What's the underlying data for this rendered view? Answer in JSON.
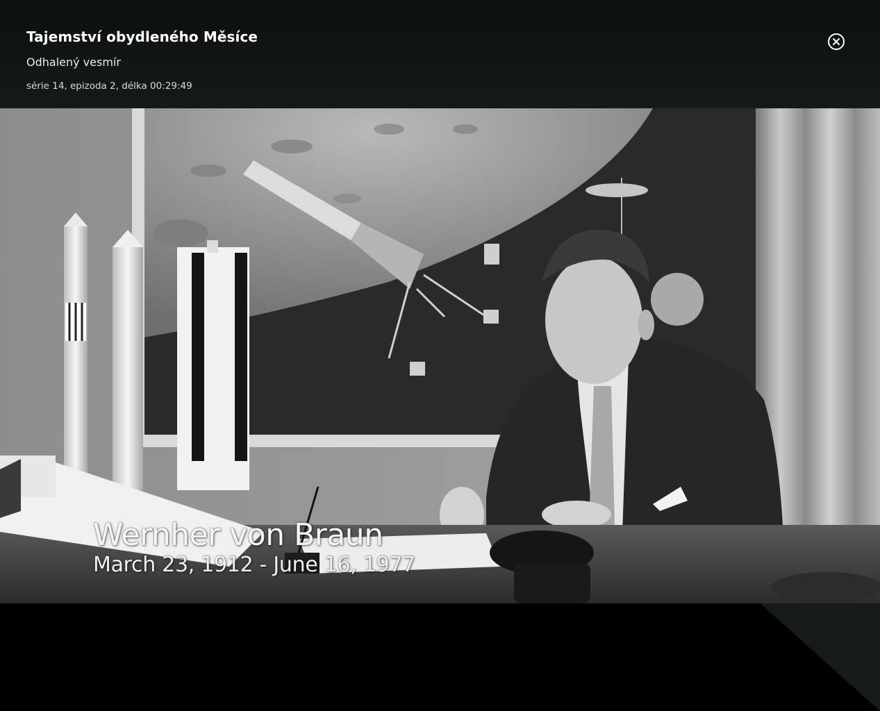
{
  "episode": {
    "title": "Tajemství obydleného Měsíce",
    "series_name": "Odhalený vesmír",
    "meta": "série 14, epizoda 2, délka 00:29:49"
  },
  "close_button": {
    "icon": "close-circle-icon",
    "aria_label": "Zavřít"
  },
  "video_frame": {
    "caption_name": "Wernher von Braun",
    "caption_dates": "March 23, 1912 - June 16, 1977"
  },
  "colors": {
    "header_bg": "#121715",
    "corner_panel": "#161c19",
    "text_primary": "#ffffff"
  }
}
